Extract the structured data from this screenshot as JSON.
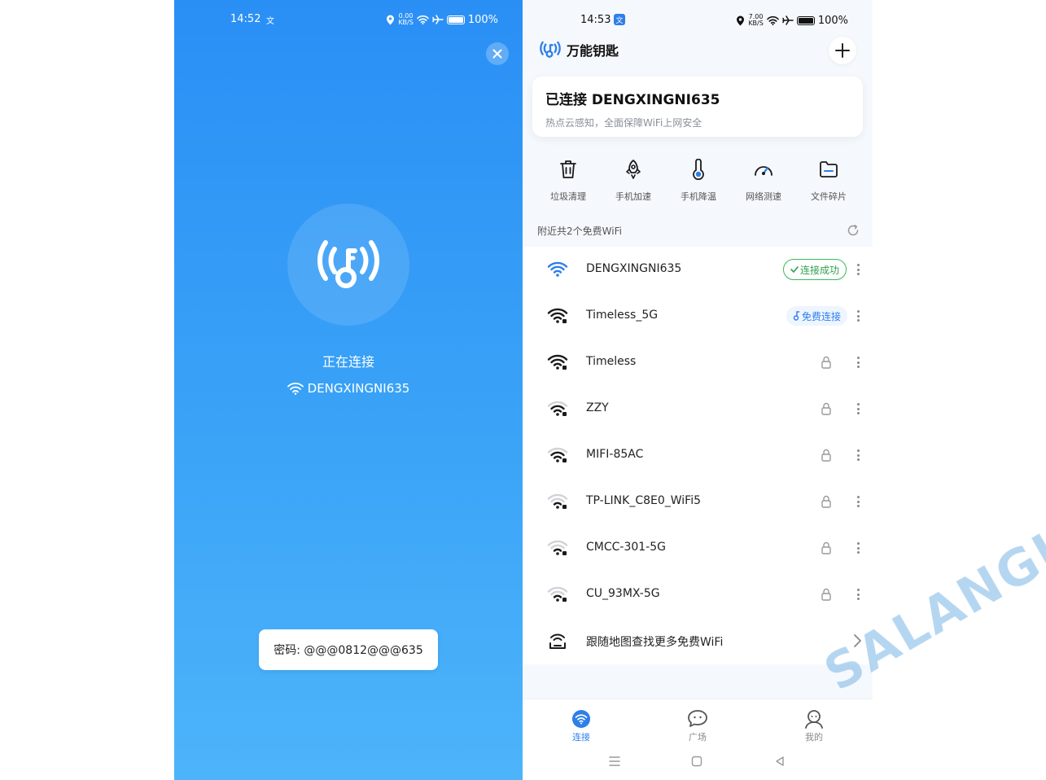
{
  "left": {
    "status": {
      "time": "14:52",
      "lang": "文",
      "speed_top": "0.00",
      "speed_bottom": "KB/S",
      "battery": "100%"
    },
    "connecting_label": "正在连接",
    "ssid": "DENGXINGNI635",
    "password": "密码: @@@0812@@@635"
  },
  "right": {
    "status": {
      "time": "14:53",
      "lang": "文",
      "speed_top": "7.00",
      "speed_bottom": "KB/S",
      "battery": "100%"
    },
    "app_title": "万能钥匙",
    "connected": {
      "title": "已连接 DENGXINGNI635",
      "subtitle": "热点云感知，全面保障WiFi上网安全"
    },
    "tools": [
      {
        "label": "垃圾清理",
        "icon": "trash-icon"
      },
      {
        "label": "手机加速",
        "icon": "rocket-icon"
      },
      {
        "label": "手机降温",
        "icon": "thermometer-icon"
      },
      {
        "label": "网络测速",
        "icon": "speedometer-icon"
      },
      {
        "label": "文件碎片",
        "icon": "folder-icon"
      }
    ],
    "nearby_label": "附近共2个免费WiFi",
    "wifi": [
      {
        "name": "DENGXINGNI635",
        "status": "connected",
        "badge": "连接成功"
      },
      {
        "name": "Timeless_5G",
        "status": "free",
        "badge": "免费连接"
      },
      {
        "name": "Timeless",
        "status": "locked"
      },
      {
        "name": "ZZY",
        "status": "locked"
      },
      {
        "name": "MIFI-85AC",
        "status": "locked"
      },
      {
        "name": "TP-LINK_C8E0_WiFi5",
        "status": "locked"
      },
      {
        "name": "CMCC-301-5G",
        "status": "locked"
      },
      {
        "name": "CU_93MX-5G",
        "status": "locked"
      }
    ],
    "map_row": "跟随地图查找更多免费WiFi",
    "tabs": [
      {
        "label": "连接",
        "icon": "wifi-tab-icon",
        "active": true
      },
      {
        "label": "广场",
        "icon": "chat-bubble-icon",
        "active": false
      },
      {
        "label": "我的",
        "icon": "user-icon",
        "active": false
      }
    ]
  },
  "watermark": "SALANGHE",
  "colors": {
    "accent": "#2e7fe8",
    "success": "#2ea04e",
    "left_bg": "#3aa3f7"
  }
}
